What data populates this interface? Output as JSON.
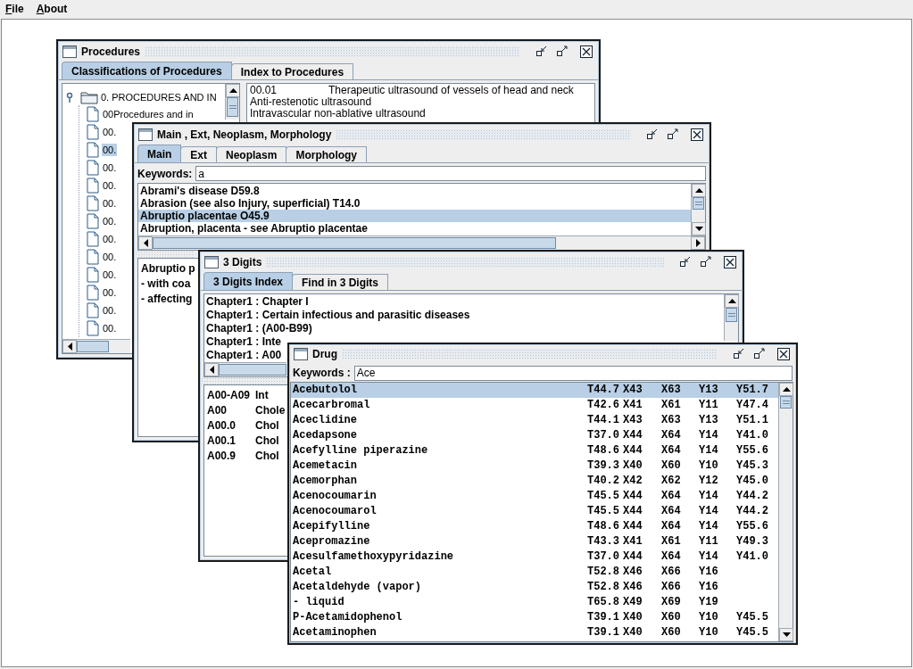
{
  "menu_bar": [
    {
      "label": "File"
    },
    {
      "label": "About"
    }
  ],
  "procedures_window": {
    "title": "Procedures",
    "tabs": [
      {
        "label": "Classifications of Procedures",
        "selected": true
      },
      {
        "label": "Index to Procedures",
        "selected": false
      }
    ],
    "tree": {
      "label": "0.  PROCEDURES AND IN",
      "expanded": true,
      "children": [
        {
          "label": "00Procedures and in",
          "selected": false
        },
        {
          "label": "00.",
          "selected": false
        },
        {
          "label": "00.",
          "selected": true
        },
        {
          "label": "00.",
          "selected": false
        },
        {
          "label": "00.",
          "selected": false
        },
        {
          "label": "00.",
          "selected": false
        },
        {
          "label": "00.",
          "selected": false
        },
        {
          "label": "00.",
          "selected": false
        },
        {
          "label": "00.",
          "selected": false
        },
        {
          "label": "00.",
          "selected": false
        },
        {
          "label": "00.",
          "selected": false
        },
        {
          "label": "00.",
          "selected": false
        },
        {
          "label": "00.",
          "selected": false
        }
      ]
    },
    "detail_lines": [
      {
        "code": "00.01",
        "text": "Therapeutic ultrasound of vessels of head and neck"
      },
      {
        "text": "Anti-restenotic ultrasound"
      },
      {
        "text": "Intravascular non-ablative ultrasound"
      }
    ]
  },
  "main_window": {
    "title": "Main , Ext, Neoplasm, Morphology",
    "tabs": [
      {
        "label": "Main",
        "selected": true
      },
      {
        "label": "Ext",
        "selected": false
      },
      {
        "label": "Neoplasm",
        "selected": false
      },
      {
        "label": "Morphology",
        "selected": false
      }
    ],
    "keywords_label": "Keywords:",
    "keywords_value": "a",
    "results": [
      {
        "text": "Abrami's disease D59.8",
        "selected": false
      },
      {
        "text": "Abrasion (see also Injury, superficial) T14.0",
        "selected": false
      },
      {
        "text": "Abruptio placentae O45.9",
        "selected": true
      },
      {
        "text": "Abruption, placenta - see Abruptio placentae",
        "selected": false
      }
    ],
    "detail_lines": [
      "Abruptio p",
      "- with coa",
      "- affecting"
    ]
  },
  "three_digits_window": {
    "title": "3 Digits",
    "tabs": [
      {
        "label": "3 Digits Index",
        "selected": true
      },
      {
        "label": "Find in 3 Digits",
        "selected": false
      }
    ],
    "chapters": [
      "Chapter1 : Chapter I",
      "Chapter1 : Certain infectious and parasitic diseases",
      "Chapter1 : (A00-B99)",
      "Chapter1 : Inte",
      "Chapter1 : A00"
    ],
    "codes": [
      {
        "code": "A00-A09",
        "text": "Int"
      },
      {
        "code": "A00",
        "text": "Chole"
      },
      {
        "code": "A00.0",
        "text": "Chol"
      },
      {
        "code": "A00.1",
        "text": "Chol"
      },
      {
        "code": "A00.9",
        "text": "Chol"
      }
    ]
  },
  "drug_window": {
    "title": "Drug",
    "keywords_label": "Keywords :",
    "keywords_value": "Ace",
    "rows": [
      {
        "cells": [
          "Acebutolol",
          "T44.7",
          "X43",
          "X63",
          "Y13",
          "Y51.7"
        ],
        "selected": true
      },
      {
        "cells": [
          "Acecarbromal",
          "T42.6",
          "X41",
          "X61",
          "Y11",
          "Y47.4"
        ],
        "selected": false
      },
      {
        "cells": [
          "Aceclidine",
          "T44.1",
          "X43",
          "X63",
          "Y13",
          "Y51.1"
        ],
        "selected": false
      },
      {
        "cells": [
          "Acedapsone",
          "T37.0",
          "X44",
          "X64",
          "Y14",
          "Y41.0"
        ],
        "selected": false
      },
      {
        "cells": [
          "Acefylline piperazine",
          "T48.6",
          "X44",
          "X64",
          "Y14",
          "Y55.6"
        ],
        "selected": false
      },
      {
        "cells": [
          "Acemetacin",
          "T39.3",
          "X40",
          "X60",
          "Y10",
          "Y45.3"
        ],
        "selected": false
      },
      {
        "cells": [
          "Acemorphan",
          "T40.2",
          "X42",
          "X62",
          "Y12",
          "Y45.0"
        ],
        "selected": false
      },
      {
        "cells": [
          "Acenocoumarin",
          "T45.5",
          "X44",
          "X64",
          "Y14",
          "Y44.2"
        ],
        "selected": false
      },
      {
        "cells": [
          "Acenocoumarol",
          "T45.5",
          "X44",
          "X64",
          "Y14",
          "Y44.2"
        ],
        "selected": false
      },
      {
        "cells": [
          "Acepifylline",
          "T48.6",
          "X44",
          "X64",
          "Y14",
          "Y55.6"
        ],
        "selected": false
      },
      {
        "cells": [
          "Acepromazine",
          "T43.3",
          "X41",
          "X61",
          "Y11",
          "Y49.3"
        ],
        "selected": false
      },
      {
        "cells": [
          "Acesulfamethoxypyridazine",
          "T37.0",
          "X44",
          "X64",
          "Y14",
          "Y41.0"
        ],
        "selected": false
      },
      {
        "cells": [
          "Acetal",
          "T52.8",
          "X46",
          "X66",
          "Y16"
        ],
        "selected": false
      },
      {
        "cells": [
          "Acetaldehyde (vapor)",
          "T52.8",
          "X46",
          "X66",
          "Y16"
        ],
        "selected": false
      },
      {
        "cells": [
          "- liquid",
          "T65.8",
          "X49",
          "X69",
          "Y19"
        ],
        "selected": false
      },
      {
        "cells": [
          "P-Acetamidophenol",
          "T39.1",
          "X40",
          "X60",
          "Y10",
          "Y45.5"
        ],
        "selected": false
      },
      {
        "cells": [
          "Acetaminophen",
          "T39.1",
          "X40",
          "X60",
          "Y10",
          "Y45.5"
        ],
        "selected": false
      }
    ]
  }
}
